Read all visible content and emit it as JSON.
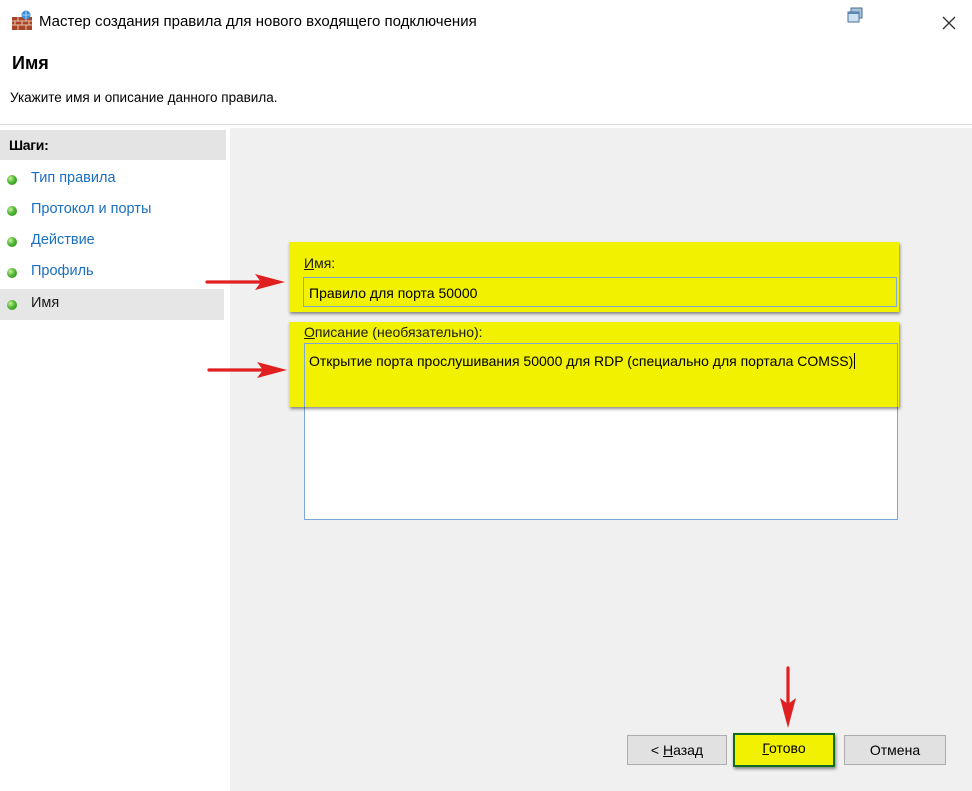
{
  "window": {
    "title": "Мастер создания правила для нового входящего подключения",
    "app_icon": "firewall-brick-icon",
    "restore_icon": "restore-window-icon",
    "close_icon": "close-icon"
  },
  "page": {
    "heading": "Имя",
    "subtitle": "Укажите имя и описание данного правила."
  },
  "sidebar": {
    "header": "Шаги:",
    "steps": [
      {
        "label": "Тип правила",
        "state": "done"
      },
      {
        "label": "Протокол и порты",
        "state": "done"
      },
      {
        "label": "Действие",
        "state": "done"
      },
      {
        "label": "Профиль",
        "state": "done"
      },
      {
        "label": "Имя",
        "state": "current"
      }
    ]
  },
  "form": {
    "name": {
      "label_mnemonic": "И",
      "label_rest": "мя:",
      "value": "Правило для порта 50000"
    },
    "description": {
      "label_mnemonic": "О",
      "label_rest": "писание (необязательно):",
      "value": "Открытие порта прослушивания 50000 для RDP (специально для портала COMSS)"
    }
  },
  "buttons": {
    "back_mnemonic": "Н",
    "back_prefix": "< ",
    "back_rest": "азад",
    "finish_mnemonic": "Г",
    "finish_rest": "отово",
    "cancel": "Отмена"
  },
  "colors": {
    "highlight": "#f1f100",
    "arrow": "#e02020",
    "link": "#1a6fc4",
    "panel": "#f0f0f0"
  }
}
